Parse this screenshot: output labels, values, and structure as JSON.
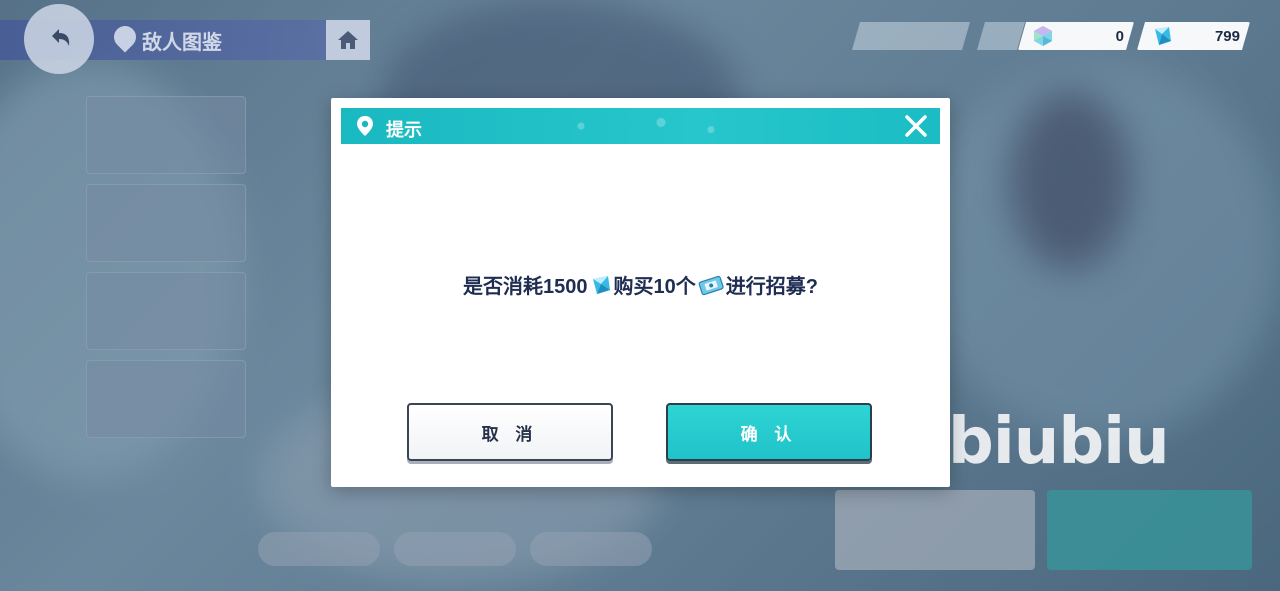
{
  "nav": {
    "location_title": "敌人图鉴",
    "back_icon": "back-arrow-icon",
    "home_icon": "home-icon"
  },
  "currency": [
    {
      "name": "crystal",
      "icon": "prism-crystal-icon",
      "value": "0"
    },
    {
      "name": "diamond",
      "icon": "blue-diamond-icon",
      "value": "799"
    }
  ],
  "dialog": {
    "title": "提示",
    "message_prefix": "是否消耗1500",
    "message_middle": "购买10个",
    "message_suffix": "进行招募?",
    "cancel_label": "取 消",
    "confirm_label": "确 认",
    "header_color": "#1ab9c1",
    "confirm_color": "#24c9cd"
  },
  "background": {
    "bottom_buttons": [
      "",
      "",
      ""
    ],
    "watermark": "biubiu"
  }
}
